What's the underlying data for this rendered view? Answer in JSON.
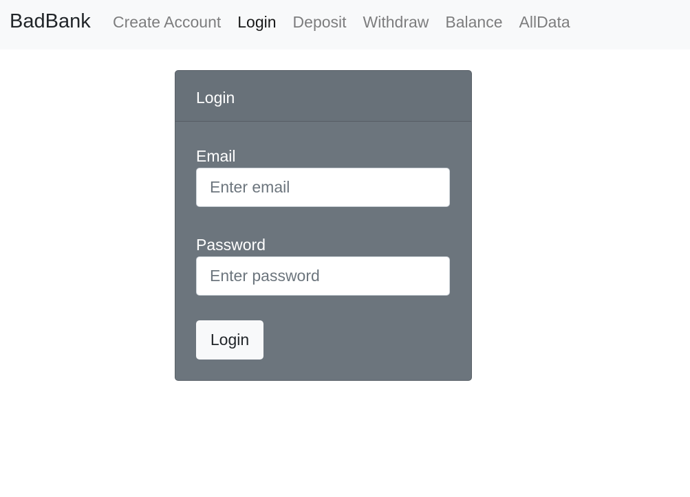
{
  "navbar": {
    "brand": "BadBank",
    "links": [
      {
        "label": "Create Account",
        "active": false
      },
      {
        "label": "Login",
        "active": true
      },
      {
        "label": "Deposit",
        "active": false
      },
      {
        "label": "Withdraw",
        "active": false
      },
      {
        "label": "Balance",
        "active": false
      },
      {
        "label": "AllData",
        "active": false
      }
    ]
  },
  "login_card": {
    "header": "Login",
    "email_label": "Email",
    "email_value": "",
    "email_placeholder": "Enter email",
    "password_label": "Password",
    "password_value": "",
    "password_placeholder": "Enter password",
    "submit_label": "Login"
  },
  "colors": {
    "navbar_bg": "#f8f9fa",
    "card_bg": "#6c757d",
    "button_bg": "#f8f9fa"
  }
}
